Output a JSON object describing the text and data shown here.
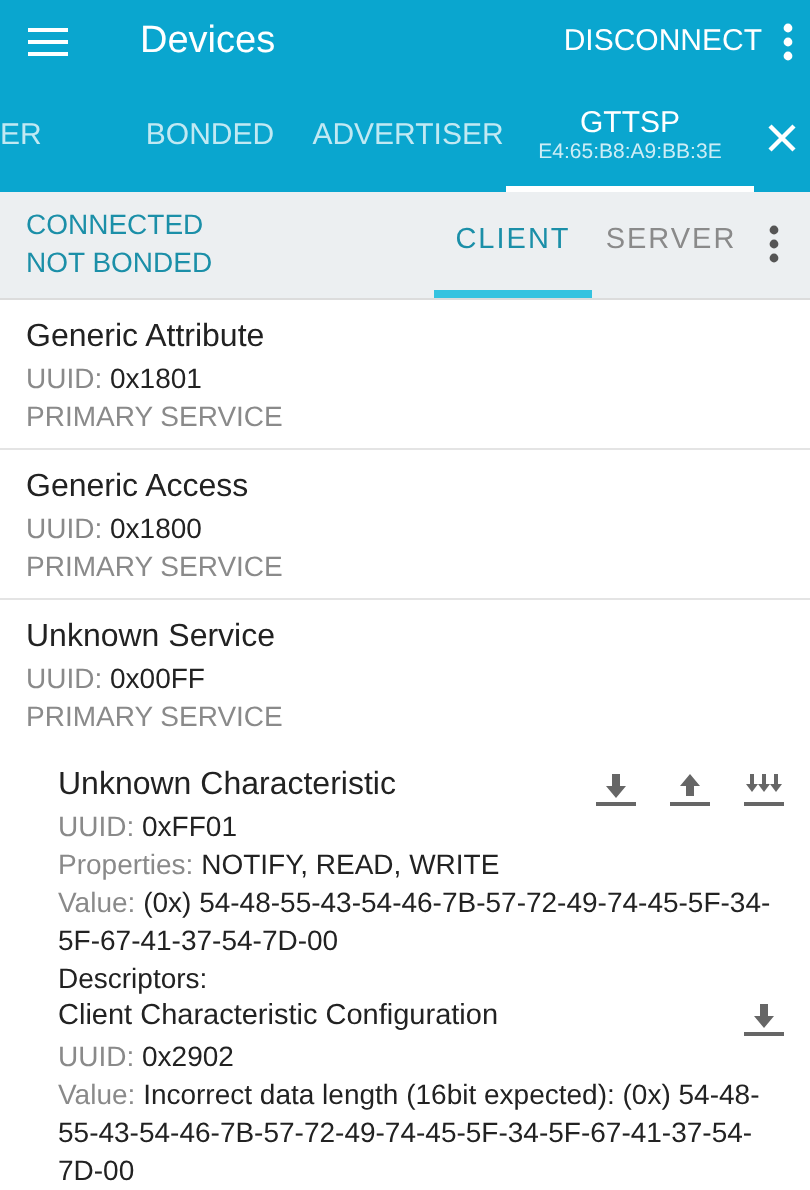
{
  "app_bar": {
    "title": "Devices",
    "action": "DISCONNECT"
  },
  "tabs": [
    {
      "label": "ER",
      "selected": false
    },
    {
      "label": "BONDED",
      "selected": false
    },
    {
      "label": "ADVERTISER",
      "selected": false
    },
    {
      "label": "GTTSP",
      "address": "E4:65:B8:A9:BB:3E",
      "selected": true
    }
  ],
  "status": [
    "CONNECTED",
    "NOT BONDED"
  ],
  "sub_tabs": [
    {
      "label": "CLIENT",
      "selected": true
    },
    {
      "label": "SERVER",
      "selected": false
    }
  ],
  "services": [
    {
      "name": "Generic Attribute",
      "uuid_label": "UUID:",
      "uuid": "0x1801",
      "type": "PRIMARY SERVICE"
    },
    {
      "name": "Generic Access",
      "uuid_label": "UUID:",
      "uuid": "0x1800",
      "type": "PRIMARY SERVICE"
    },
    {
      "name": "Unknown Service",
      "uuid_label": "UUID:",
      "uuid": "0x00FF",
      "type": "PRIMARY SERVICE",
      "characteristics": [
        {
          "name": "Unknown Characteristic",
          "actions": [
            {
              "kind": "read"
            },
            {
              "kind": "write"
            },
            {
              "kind": "notify"
            }
          ],
          "fields": [
            {
              "label": "UUID:",
              "value": "0xFF01"
            },
            {
              "label": "Properties:",
              "value": "NOTIFY, READ, WRITE"
            },
            {
              "label": "Value:",
              "value": "(0x) 54-48-55-43-54-46-7B-57-72-49-74-45-5F-34-5F-67-41-37-54-7D-00"
            }
          ],
          "descriptors_heading": "Descriptors:",
          "descriptors": [
            {
              "name": "Client Characteristic Configuration",
              "actions": [
                {
                  "kind": "read"
                }
              ],
              "fields": [
                {
                  "label": "UUID:",
                  "value": "0x2902"
                },
                {
                  "label": "Value:",
                  "value": "Incorrect data length (16bit expected): (0x) 54-48-55-43-54-46-7B-57-72-49-74-45-5F-34-5F-67-41-37-54-7D-00"
                }
              ]
            }
          ]
        }
      ]
    }
  ]
}
